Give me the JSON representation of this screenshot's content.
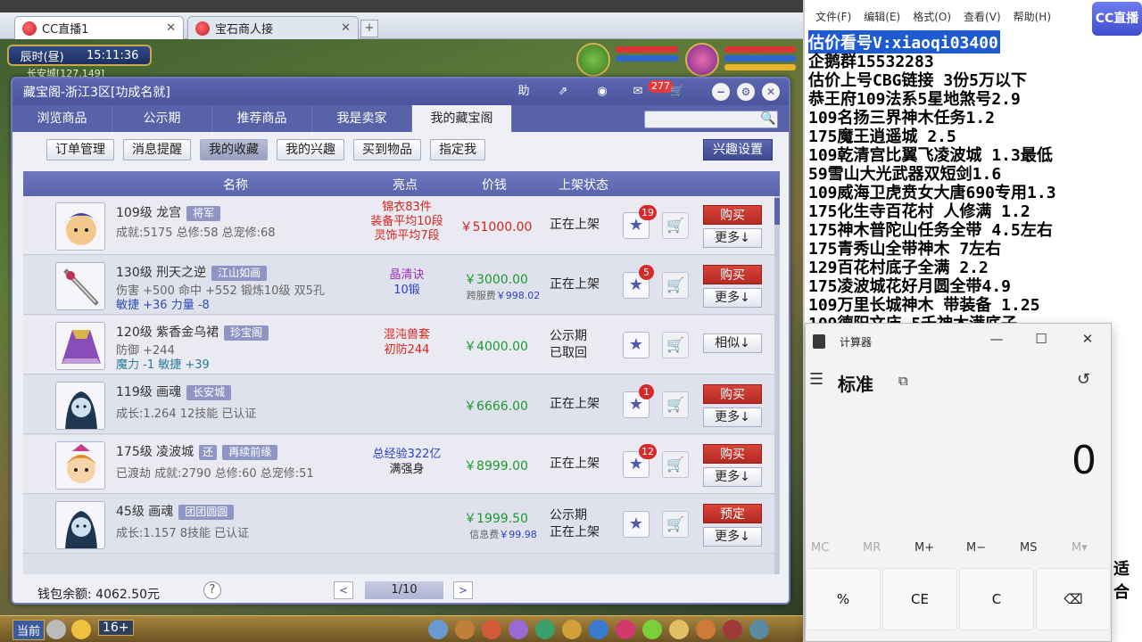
{
  "browser": {
    "tabs": [
      {
        "label": "CC直播1",
        "active": true
      },
      {
        "label": "宝石商人接",
        "active": false
      }
    ]
  },
  "game": {
    "time_period": "辰时(昼)",
    "time": "15:11:36",
    "location": "长安城[127,149]",
    "bar_current": "当前",
    "bar_age": "16+"
  },
  "shop": {
    "title": "藏宝阁-浙江3区[功成名就]",
    "toolbar": {
      "help_label": "助",
      "msg_count": "277"
    },
    "tabs": [
      "浏览商品",
      "公示期",
      "推荐商品",
      "我是卖家",
      "我的藏宝阁"
    ],
    "active_tab": 4,
    "subtabs": [
      "订单管理",
      "消息提醒",
      "我的收藏",
      "我的兴趣",
      "买到物品",
      "指定我"
    ],
    "active_subtab": 2,
    "interest_settings": "兴趣设置",
    "columns": {
      "name": "名称",
      "highlight": "亮点",
      "price": "价钱",
      "status": "上架状态"
    },
    "rows": [
      {
        "title": "109级 龙宫",
        "tag": "将军",
        "line2": "成就:5175 总修:58 总宠修:68",
        "line3": "",
        "highlight": [
          "锦衣83件",
          "装备平均10段",
          "灵饰平均7段"
        ],
        "price": "￥51000.00",
        "fee": "",
        "status": [
          "正在上架"
        ],
        "fav_count": "19",
        "action": "购买",
        "more": "更多↓"
      },
      {
        "title": "130级 刑天之逆",
        "tag": "江山如画",
        "line2": "伤害 +500 命中 +552 锻炼10级 双5孔",
        "line3": "敏捷 +36 力量 -8",
        "highlight": [
          "晶清诀",
          "10锻"
        ],
        "price": "￥3000.00",
        "fee_label": "跨服费",
        "fee": "￥998.02",
        "status": [
          "正在上架"
        ],
        "fav_count": "5",
        "action": "购买",
        "more": "更多↓"
      },
      {
        "title": "120级 紫香金乌裙",
        "tag": "珍宝阁",
        "line2": "防御 +244",
        "line3": "魔力 -1 敏捷 +39",
        "highlight": [
          "混沌兽套",
          "初防244"
        ],
        "price": "￥4000.00",
        "fee": "",
        "status": [
          "公示期",
          "已取回"
        ],
        "fav_count": "",
        "action": "",
        "more": "相似↓"
      },
      {
        "title": "119级 画魂",
        "tag": "长安城",
        "line2": "成长:1.264 12技能 已认证",
        "line3": "",
        "highlight": [],
        "price": "￥6666.00",
        "fee": "",
        "status": [
          "正在上架"
        ],
        "fav_count": "1",
        "action": "购买",
        "more": "更多↓"
      },
      {
        "title": "175级 凌波城",
        "tag_small": "还",
        "tag": "再续前缘",
        "line2": "已渡劫 成就:2790 总修:60 总宠修:51",
        "line3": "",
        "highlight": [
          "总经验322亿",
          "满强身"
        ],
        "price": "￥8999.00",
        "fee": "",
        "status": [
          "正在上架"
        ],
        "fav_count": "12",
        "action": "购买",
        "more": "更多↓"
      },
      {
        "title": "45级 画魂",
        "tag": "团团圆圆",
        "line2": "成长:1.157 8技能 已认证",
        "line3": "",
        "highlight": [],
        "price": "￥1999.50",
        "fee_label": "信息费",
        "fee": "￥99.98",
        "status": [
          "公示期",
          "正在上架"
        ],
        "fav_count": "",
        "action": "预定",
        "more": "更多↓"
      }
    ],
    "wallet": "钱包余额: 4062.50元",
    "help": "?",
    "page": "1/10"
  },
  "notepad": {
    "menu": [
      "文件(F)",
      "编辑(E)",
      "格式(O)",
      "查看(V)",
      "帮助(H)"
    ],
    "logo": "CC直播",
    "lines": [
      "估价看号V:xiaoqi03400",
      "企鹅群15532283",
      "估价上号CBG链接 3份5万以下",
      "恭王府109法系5星地煞号2.9",
      "109名扬三界神木任务1.2",
      "175魔王逍遥城 2.5",
      "109乾清宫比翼飞凌波城 1.3最低",
      "59雪山大光武器双短剑1.6",
      "109威海卫虎贲女大唐690专用1.3",
      "175化生寺百花村 人修满 1.2",
      "175神木普陀山任务全带 4.5左右",
      "175青秀山全带神木  7左右",
      "129百花村底子全满 2.2",
      "175凌波城花好月圆全带4.9",
      "109万里长城神木 带装备  1.25",
      "109德阳文庙 5千神木满底子"
    ],
    "side_fragment": "适合"
  },
  "calculator": {
    "title": "计算器",
    "mode": "标准",
    "display": "0",
    "memory": [
      "MC",
      "MR",
      "M+",
      "M−",
      "MS",
      "M▾"
    ],
    "keys": [
      "%",
      "CE",
      "C",
      "⌫"
    ]
  }
}
